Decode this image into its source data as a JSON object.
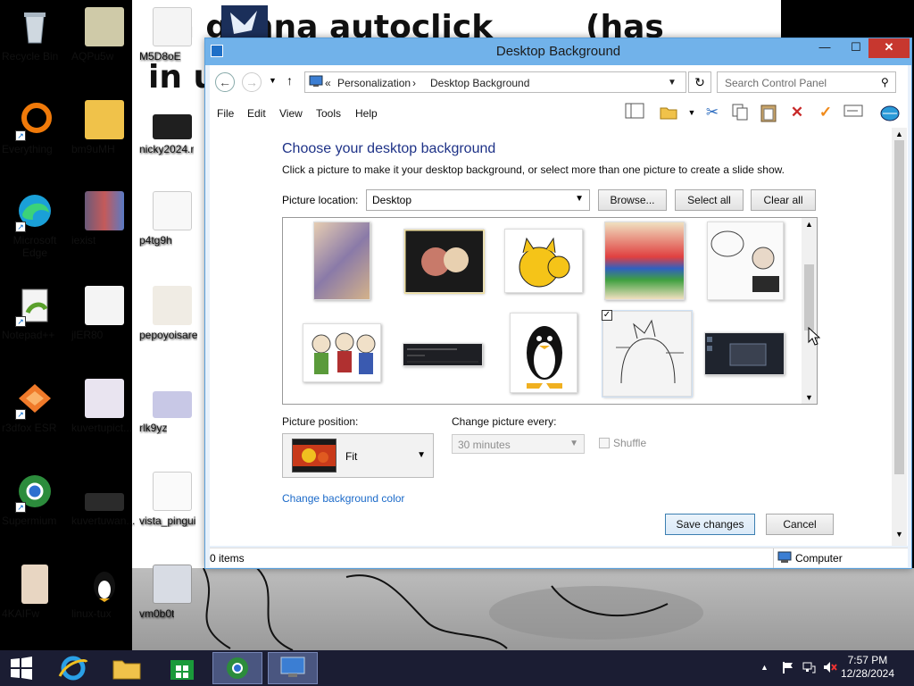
{
  "desktop": {
    "icons": [
      {
        "label": "Recycle Bin"
      },
      {
        "label": "AQPu5w"
      },
      {
        "label": "Everything"
      },
      {
        "label": "bm9uMH"
      },
      {
        "label": "Microsoft Edge"
      },
      {
        "label": "iexist"
      },
      {
        "label": "Notepad++"
      },
      {
        "label": "jlER80"
      },
      {
        "label": "r3dfox ESR"
      },
      {
        "label": "kuvertupict..."
      },
      {
        "label": "Supermium"
      },
      {
        "label": "kuvertuwan..."
      },
      {
        "label": "4KAIFw"
      },
      {
        "label": "linux-tux"
      },
      {
        "label": "M5D8oE"
      },
      {
        "label": "nicky2024.r"
      },
      {
        "label": "p4tg9h"
      },
      {
        "label": "pepoyoisare"
      },
      {
        "label": "rlk9yz"
      },
      {
        "label": "vista_pingui"
      },
      {
        "label": "vm0b0t"
      }
    ],
    "wallpaper_text_1": "im gonna autoclick",
    "wallpaper_text_2": "(has",
    "wallpaper_text_3": "in u"
  },
  "window": {
    "title": "Desktop Background",
    "minimize": "—",
    "maximize": "☐",
    "close": "✕",
    "breadcrumb": {
      "prefix": "«",
      "part1": "Personalization",
      "separator": "›",
      "part2": "Desktop Background"
    },
    "search_placeholder": "Search Control Panel",
    "menu": [
      "File",
      "Edit",
      "View",
      "Tools",
      "Help"
    ],
    "heading": "Choose your desktop background",
    "subtext": "Click a picture to make it your desktop background, or select more than one picture to create a slide show.",
    "picture_location_label": "Picture location:",
    "picture_location_value": "Desktop",
    "browse_button": "Browse...",
    "select_all_button": "Select all",
    "clear_all_button": "Clear all",
    "picture_position_label": "Picture position:",
    "picture_position_value": "Fit",
    "change_every_label": "Change picture every:",
    "change_every_value": "30 minutes",
    "shuffle_label": "Shuffle",
    "change_color_link": "Change background color",
    "save_button": "Save changes",
    "cancel_button": "Cancel",
    "status_items": "0 items",
    "status_computer": "Computer"
  },
  "thumbs": [
    {
      "name": "collage"
    },
    {
      "name": "kawaii-couple"
    },
    {
      "name": "ava-cat"
    },
    {
      "name": "pride-group"
    },
    {
      "name": "im-cumming-sketch"
    },
    {
      "name": "cartoon-group"
    },
    {
      "name": "terminal-dark"
    },
    {
      "name": "tux-penguin"
    },
    {
      "name": "gonna-autoclick",
      "checked": true
    },
    {
      "name": "dark-desktop"
    }
  ],
  "taskbar": {
    "time": "7:57 PM",
    "date": "12/28/2024",
    "tray_up": "▲"
  }
}
